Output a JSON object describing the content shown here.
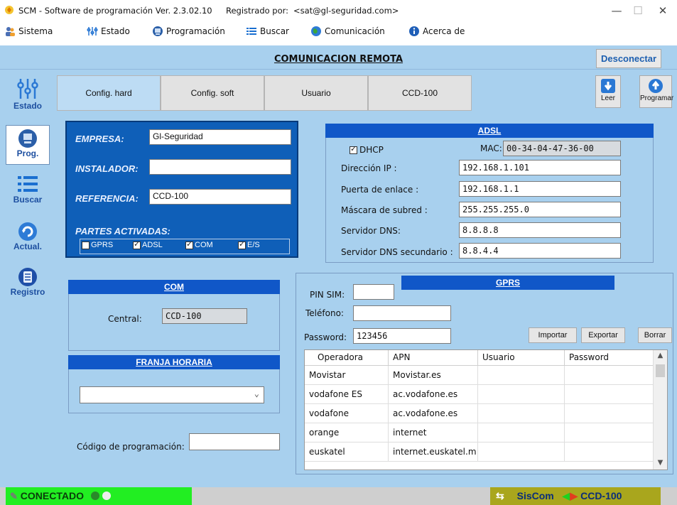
{
  "window": {
    "title": "SCM - Software de programación Ver. 2.3.02.10",
    "registered_label": "Registrado por:",
    "registered_email": "<sat@gl-seguridad.com>",
    "minimize": "—",
    "maximize": "☐",
    "close": "✕"
  },
  "menu": {
    "items": [
      {
        "label": "Sistema",
        "icon": "users-icon"
      },
      {
        "label": "Estado",
        "icon": "network-icon"
      },
      {
        "label": "Programación",
        "icon": "disk-icon"
      },
      {
        "label": "Buscar",
        "icon": "list-icon"
      },
      {
        "label": "Comunicación",
        "icon": "globe-icon"
      },
      {
        "label": "Acerca de",
        "icon": "info-icon"
      }
    ]
  },
  "header": {
    "title": "COMUNICACION REMOTA",
    "disconnect": "Desconectar"
  },
  "sidebar": {
    "items": [
      {
        "label": "Estado",
        "icon": "network-icon"
      },
      {
        "label": "Prog.",
        "icon": "disk-icon"
      },
      {
        "label": "Buscar",
        "icon": "list-icon"
      },
      {
        "label": "Actual.",
        "icon": "refresh-icon"
      },
      {
        "label": "Registro",
        "icon": "document-icon"
      }
    ]
  },
  "tabs": [
    {
      "label": "Config. hard"
    },
    {
      "label": "Config. soft"
    },
    {
      "label": "Usuario"
    },
    {
      "label": "CCD-100"
    }
  ],
  "toolbar": {
    "read": "Leer",
    "program": "Programar"
  },
  "company": {
    "empresa_label": "EMPRESA:",
    "empresa_value": "Gl-Seguridad",
    "instalador_label": "INSTALADOR:",
    "instalador_value": "",
    "referencia_label": "REFERENCIA:",
    "referencia_value": "CCD-100",
    "partes_label": "PARTES ACTIVADAS:",
    "parts": [
      {
        "label": "GPRS",
        "checked": false
      },
      {
        "label": "ADSL",
        "checked": true
      },
      {
        "label": "COM",
        "checked": true
      },
      {
        "label": "E/S",
        "checked": true
      }
    ]
  },
  "adsl": {
    "title": "ADSL",
    "dhcp_label": "DHCP",
    "dhcp_checked": true,
    "mac_label": "MAC:",
    "mac_value": "00-34-04-47-36-00",
    "ip_label": "Dirección IP :",
    "ip_value": "192.168.1.101",
    "gateway_label": "Puerta de enlace :",
    "gateway_value": "192.168.1.1",
    "mask_label": "Máscara de subred :",
    "mask_value": "255.255.255.0",
    "dns_label": "Servidor DNS:",
    "dns_value": "8.8.8.8",
    "dns2_label": "Servidor DNS secundario :",
    "dns2_value": "8.8.4.4"
  },
  "com": {
    "title": "COM",
    "central_label": "Central:",
    "central_value": "CCD-100"
  },
  "franja": {
    "title": "FRANJA HORARIA",
    "selected": ""
  },
  "codigo": {
    "label": "Código de programación:",
    "value": ""
  },
  "gprs": {
    "title": "GPRS",
    "pin_label": "PIN SIM:",
    "pin_value": "",
    "phone_label": "Teléfono:",
    "phone_value": "",
    "password_label": "Password:",
    "password_value": "123456",
    "import": "Importar",
    "export": "Exportar",
    "delete": "Borrar",
    "columns": [
      "Operadora",
      "APN",
      "Usuario",
      "Password"
    ],
    "rows": [
      [
        "Movistar",
        "Movistar.es",
        "",
        ""
      ],
      [
        "vodafone ES",
        "ac.vodafone.es",
        "",
        ""
      ],
      [
        "vodafone",
        "ac.vodafone.es",
        "",
        ""
      ],
      [
        "orange",
        "internet",
        "",
        ""
      ],
      [
        "euskatel",
        "internet.euskatel.m",
        "",
        ""
      ]
    ]
  },
  "status": {
    "connected": "CONECTADO",
    "siscom": "SisCom",
    "device": "CCD-100"
  },
  "colors": {
    "bg": "#a8d0ee",
    "company_panel": "#0f5fb8",
    "section_header": "#1057c8",
    "connected": "#22ee22",
    "siscom_bar": "#a9a61d"
  }
}
